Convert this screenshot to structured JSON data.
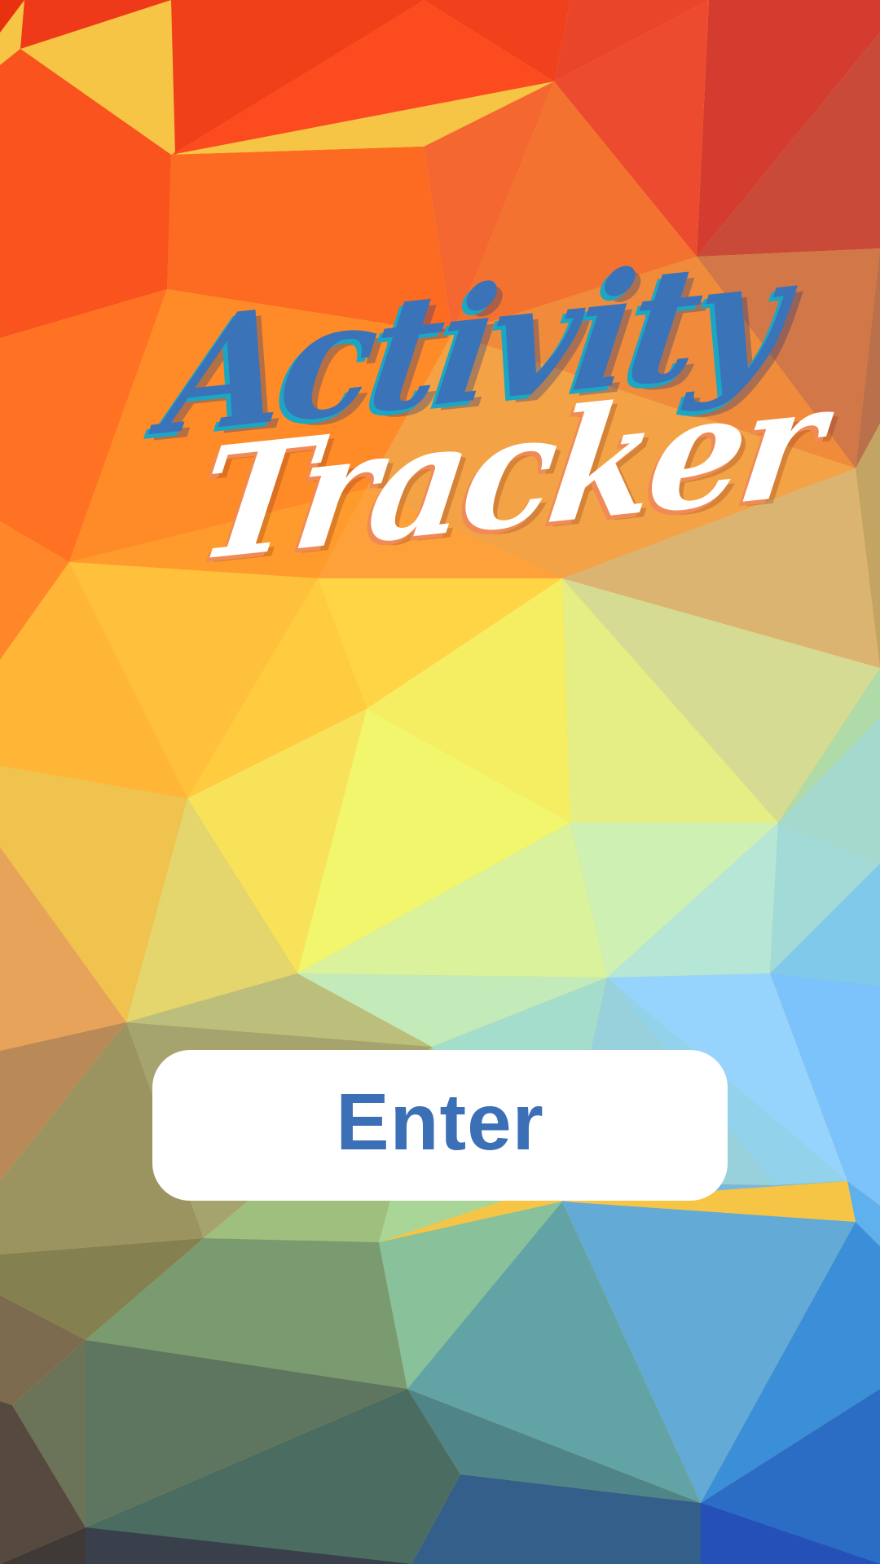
{
  "logo": {
    "line1": "Activity",
    "line2": "Tracker"
  },
  "enter_button": {
    "label": "Enter"
  },
  "colors": {
    "logo_blue": "#3b73b9",
    "logo_blue_outline": "#1ba7c4",
    "logo_white": "#ffffff",
    "logo_white_outline": "#f08a56",
    "button_background": "#ffffff",
    "button_text": "#3b6fb6"
  },
  "background": {
    "style": "low-poly rainbow gradient"
  }
}
